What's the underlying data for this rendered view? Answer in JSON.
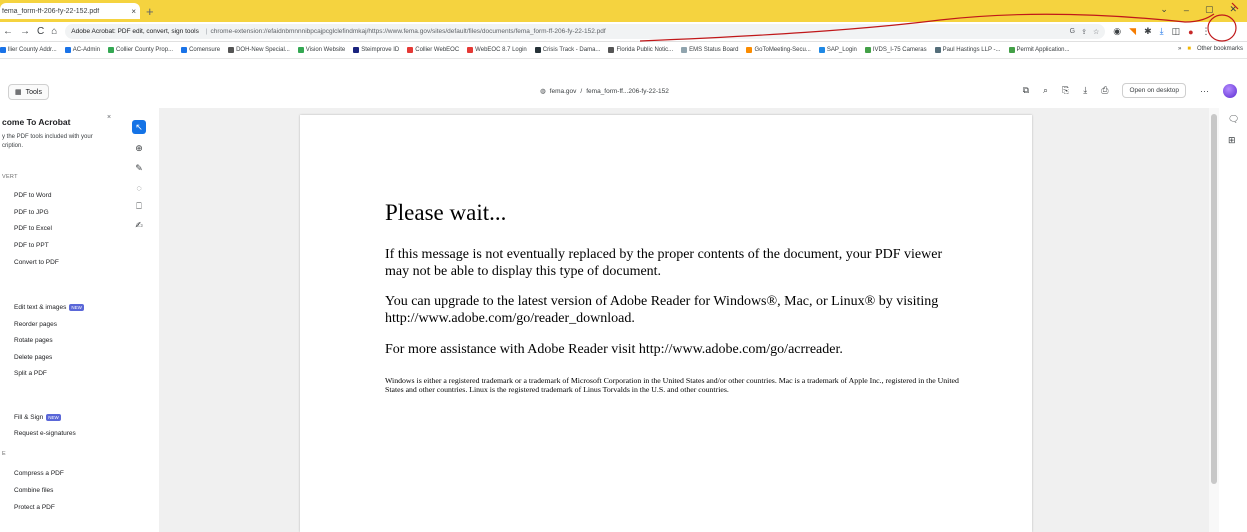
{
  "browser": {
    "tab_title": "fema_form-ff-206-fy-22-152.pdf",
    "tab_close": "×",
    "new_tab": "+",
    "window_controls": [
      "⌄",
      "–",
      "▢",
      "✕"
    ],
    "nav": [
      "←",
      "→",
      "C",
      "⌂"
    ],
    "site_label": "Adobe Acrobat: PDF edit, convert, sign tools",
    "url": "chrome-extension://efaidnbmnnnibpcajpcglclefindmkaj/https://www.fema.gov/sites/default/files/documents/fema_form-ff-206-fy-22-152.pdf",
    "omni_icons": [
      "G",
      "⇪",
      "☆"
    ],
    "ext_icons": [
      "◉",
      "◥",
      "✱",
      "⤓",
      "◫",
      "●",
      "⋮"
    ],
    "bookmarks": [
      {
        "label": "llier County Addr...",
        "color": "#1a73e8"
      },
      {
        "label": "AC-Admin",
        "color": "#1a73e8"
      },
      {
        "label": "Collier County Prop...",
        "color": "#34a853"
      },
      {
        "label": "Comensure",
        "color": "#1a73e8"
      },
      {
        "label": "DOH-New Special...",
        "color": "#555555"
      },
      {
        "label": "Vision Website",
        "color": "#34a853"
      },
      {
        "label": "Steimprove ID",
        "color": "#1a237e"
      },
      {
        "label": "Collier WebEOC",
        "color": "#e53935"
      },
      {
        "label": "WebEOC 8.7 Login",
        "color": "#e53935"
      },
      {
        "label": "Crisis Track - Dama...",
        "color": "#263238"
      },
      {
        "label": "Florida Public Notic...",
        "color": "#555555"
      },
      {
        "label": "EMS Status Board",
        "color": "#90a4ae"
      },
      {
        "label": "GoToMeeting-Secu...",
        "color": "#fb8c00"
      },
      {
        "label": "SAP_Login",
        "color": "#1e88e5"
      },
      {
        "label": "IVDS_I-75 Cameras",
        "color": "#43a047"
      },
      {
        "label": "Paul Hastings LLP -...",
        "color": "#546e7a"
      },
      {
        "label": "Permit Application...",
        "color": "#43a047"
      }
    ],
    "bookmarks_more": "»",
    "other_bookmarks": "Other bookmarks"
  },
  "acrobat": {
    "tools_label": "Tools",
    "breadcrumb_site": "fema.gov",
    "breadcrumb_sep": "/",
    "breadcrumb_file": "fema_form-ff...206-fy-22-152",
    "actions": [
      "⧉",
      "⌕",
      "⎘",
      "⤓",
      "⎙"
    ],
    "open_desktop": "Open on desktop",
    "more": "···"
  },
  "left_panel": {
    "welcome_title": "come To Acrobat",
    "close": "×",
    "welcome_desc": "y the PDF tools included with your cription.",
    "convert_head": "VERT",
    "convert_items": [
      "PDF to Word",
      "PDF to JPG",
      "PDF to Excel",
      "PDF to PPT",
      "Convert to PDF"
    ],
    "edit_items": [
      "Edit text & images",
      "Reorder pages",
      "Rotate pages",
      "Delete pages",
      "Split a PDF"
    ],
    "new_badge": "NEW",
    "sign_items": [
      "Fill & Sign",
      "Request e-signatures"
    ],
    "other_head": "E",
    "other_items": [
      "Compress a PDF",
      "Combine files",
      "Protect a PDF"
    ]
  },
  "tool_rail": [
    "↖",
    "⊕",
    "✎",
    "◌",
    "⎕",
    "✍"
  ],
  "document": {
    "heading": "Please wait...",
    "p1": "If this message is not eventually replaced by the proper contents of the document, your PDF viewer may not be able to display this type of document.",
    "p2": "You can upgrade to the latest version of Adobe Reader for Windows®, Mac, or Linux® by visiting  http://www.adobe.com/go/reader_download.",
    "p3": "For more assistance with Adobe Reader visit  http://www.adobe.com/go/acrreader.",
    "fine_print": "Windows is either a registered trademark or a trademark of Microsoft Corporation in the United States and/or other countries. Mac is a trademark of Apple Inc., registered in the United States and other countries. Linux is the registered trademark of Linus Torvalds in the U.S. and other countries."
  },
  "side_icons": [
    "🗨",
    "⊞"
  ],
  "colors": {
    "tabstrip": "#f5d33f",
    "annotation": "#c0181a",
    "accent": "#1473e6"
  }
}
